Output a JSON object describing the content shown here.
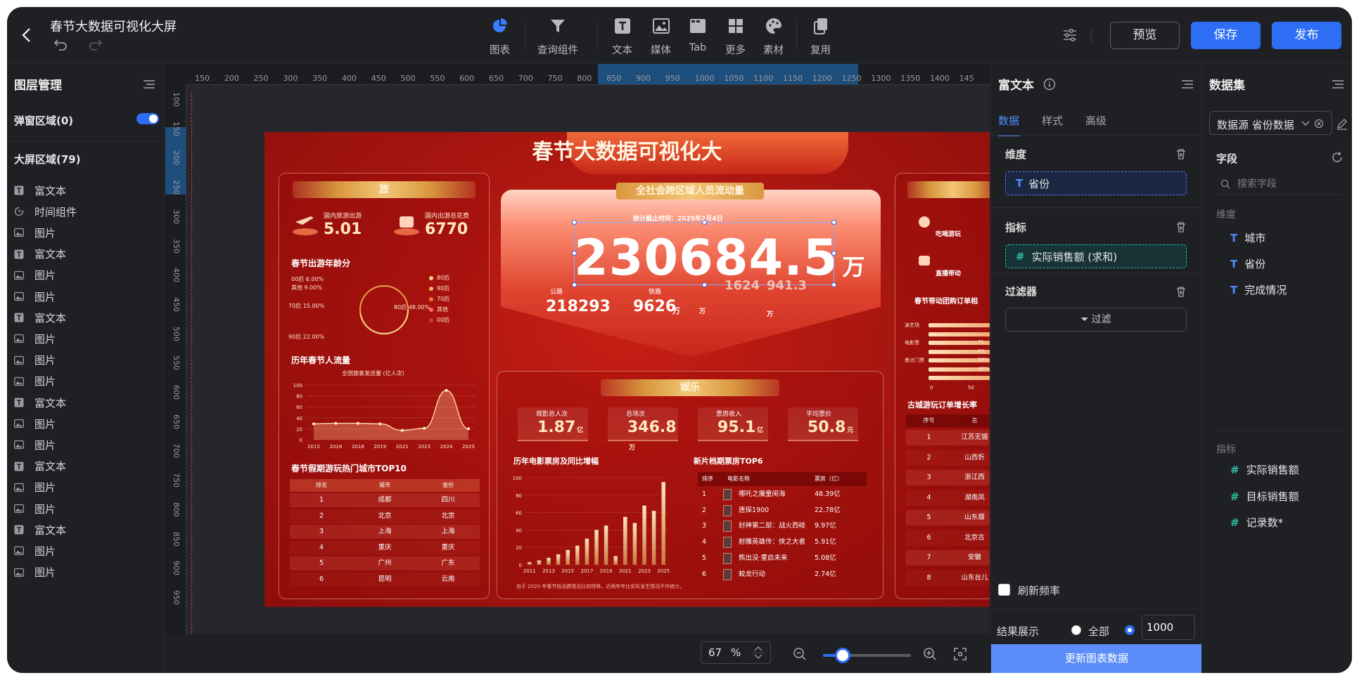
{
  "header": {
    "title": "春节大数据可视化大屏",
    "tools": [
      {
        "label": "图表",
        "icon": "pie-chart-icon"
      },
      {
        "label": "查询组件",
        "icon": "funnel-icon"
      },
      {
        "label": "文本",
        "icon": "text-icon"
      },
      {
        "label": "媒体",
        "icon": "image-icon"
      },
      {
        "label": "Tab",
        "icon": "tab-icon"
      },
      {
        "label": "更多",
        "icon": "grid-icon"
      },
      {
        "label": "素材",
        "icon": "palette-icon"
      },
      {
        "label": "复用",
        "icon": "copy-icon"
      }
    ],
    "preview": "预览",
    "save": "保存",
    "publish": "发布"
  },
  "layers": {
    "title": "图层管理",
    "popup_area": "弹窗区域(0)",
    "screen_area": "大屏区域(79)",
    "items": [
      {
        "label": "富文本",
        "type": "text"
      },
      {
        "label": "时间组件",
        "type": "time"
      },
      {
        "label": "图片",
        "type": "image"
      },
      {
        "label": "富文本",
        "type": "text"
      },
      {
        "label": "图片",
        "type": "image"
      },
      {
        "label": "图片",
        "type": "image"
      },
      {
        "label": "富文本",
        "type": "text"
      },
      {
        "label": "图片",
        "type": "image"
      },
      {
        "label": "图片",
        "type": "image"
      },
      {
        "label": "图片",
        "type": "image"
      },
      {
        "label": "富文本",
        "type": "text"
      },
      {
        "label": "图片",
        "type": "image"
      },
      {
        "label": "图片",
        "type": "image"
      },
      {
        "label": "富文本",
        "type": "text"
      },
      {
        "label": "图片",
        "type": "image"
      },
      {
        "label": "图片",
        "type": "image"
      },
      {
        "label": "富文本",
        "type": "text"
      },
      {
        "label": "图片",
        "type": "image"
      },
      {
        "label": "图片",
        "type": "image"
      }
    ]
  },
  "canvas": {
    "ruler_h": [
      "150",
      "200",
      "250",
      "300",
      "350",
      "400",
      "450",
      "500",
      "550",
      "600",
      "650",
      "700",
      "750",
      "800",
      "850",
      "900",
      "950",
      "1000",
      "1050",
      "1100",
      "1150",
      "1200",
      "1250",
      "1300",
      "1350",
      "1400",
      "145"
    ],
    "ruler_v": [
      "100",
      "150",
      "200",
      "250",
      "300",
      "350",
      "400",
      "450",
      "500",
      "550",
      "600",
      "650",
      "700",
      "750",
      "800",
      "850",
      "900",
      "950"
    ],
    "zoom_value": "67",
    "zoom_unit": "%"
  },
  "dashboard": {
    "title": "春节大数据可视化大",
    "travel": {
      "title": "旅",
      "domestic_trips_label": "国内旅游出游",
      "domestic_trips_value": "5.01",
      "domestic_spend_label": "国内出游总花费",
      "domestic_spend_value": "6770",
      "age_title": "春节出游年龄分",
      "age_labels": [
        "00后 6.00%",
        "其他 9.00%",
        "70后 15.00%",
        "90后 22.00%",
        "80后 48.00%"
      ],
      "legend": [
        "80后",
        "90后",
        "70后",
        "其他",
        "00后"
      ],
      "flow_title": "历年春节人流量",
      "flow_legend": "全国旅客发送量 (亿人次)",
      "flow_years": [
        "2015",
        "2016",
        "2018",
        "2019",
        "2021",
        "2023",
        "2024",
        "2025"
      ],
      "flow_y": [
        "100",
        "80",
        "60",
        "40",
        "20",
        "0"
      ],
      "top10_title": "春节假期游玩热门城市TOP10",
      "top10_headers": [
        "排名",
        "城市",
        "省份"
      ],
      "top10_rows": [
        [
          "1",
          "成都",
          "四川"
        ],
        [
          "2",
          "北京",
          "北京"
        ],
        [
          "3",
          "上海",
          "上海"
        ],
        [
          "4",
          "重庆",
          "重庆"
        ],
        [
          "5",
          "广州",
          "广东"
        ],
        [
          "6",
          "昆明",
          "云南"
        ]
      ]
    },
    "flow": {
      "title": "全社会跨区域人员流动量",
      "as_of": "统计截止时间：2025年2月4日",
      "total": "230684.5",
      "total_unit": "万",
      "road_label": "公路",
      "road_value": "218293",
      "rail_label": "铁路",
      "rail_value": "9626",
      "unit": "万",
      "hidden_a": "1624",
      "hidden_b": "941.3"
    },
    "ent": {
      "title": "娱乐",
      "kpis": [
        {
          "label": "观影总人次",
          "value": "1.87",
          "unit": "亿"
        },
        {
          "label": "总场次",
          "value": "346.8",
          "unit": "万"
        },
        {
          "label": "票房收入",
          "value": "95.1",
          "unit": "亿"
        },
        {
          "label": "平均票价",
          "value": "50.8",
          "unit": "元"
        }
      ],
      "box_title": "历年电影票房及同比增幅",
      "box_years": [
        "2011",
        "2013",
        "2015",
        "2017",
        "2019",
        "2021",
        "2023",
        "2025"
      ],
      "box_y": [
        "100",
        "80",
        "60",
        "40",
        "20",
        "0"
      ],
      "box_note": "由于 2020 年春节档消费情况比较特殊，近两年年比实际发生情况不作统计。",
      "top6_title": "新片档期票房TOP6",
      "top6_headers": [
        "排序",
        "电影名称",
        "票房（亿）"
      ],
      "top6_rows": [
        [
          "1",
          "哪吒之魔童闹海",
          "48.39亿"
        ],
        [
          "2",
          "唐探1900",
          "22.78亿"
        ],
        [
          "3",
          "封神第二部：战火西岐",
          "9.97亿"
        ],
        [
          "4",
          "射雕英雄传：侠之大者",
          "5.91亿"
        ],
        [
          "5",
          "熊出没·重启未来",
          "5.08亿"
        ],
        [
          "6",
          "蛟龙行动",
          "2.74亿"
        ]
      ]
    },
    "right": {
      "food_label": "吃喝游玩",
      "live_label": "直播带动",
      "orders_title": "春节带动团购订单相",
      "bar_labels": [
        "演艺场",
        "电影票",
        "景点门票"
      ],
      "pct": [
        "71",
        "69",
        "58%",
        "48%"
      ],
      "axis": [
        "0",
        "50"
      ],
      "growth_title": "古城游玩订单增长率",
      "growth_headers": [
        "序号",
        "古"
      ],
      "growth_rows": [
        [
          "1",
          "江苏无锡"
        ],
        [
          "2",
          "山西忻"
        ],
        [
          "3",
          "浙江西"
        ],
        [
          "4",
          "湖南凤"
        ],
        [
          "5",
          "山东烟"
        ],
        [
          "6",
          "北京古"
        ],
        [
          "7",
          "安徽"
        ],
        [
          "8",
          "山东台儿"
        ]
      ]
    }
  },
  "props": {
    "title": "富文本",
    "tabs": [
      "数据",
      "样式",
      "高级"
    ],
    "dimension_label": "维度",
    "dimension_field": "省份",
    "measure_label": "指标",
    "measure_field": "实际销售额 (求和)",
    "filter_label": "过滤器",
    "filter_button": "过滤",
    "refresh_label": "刷新频率",
    "result_label": "结果展示",
    "result_all": "全部",
    "result_count": "1000",
    "update_button": "更新图表数据"
  },
  "dataset": {
    "title": "数据集",
    "source": "数据源 省份数据",
    "fields_label": "字段",
    "search_placeholder": "搜索字段",
    "dim_label": "维度",
    "dimensions": [
      "城市",
      "省份",
      "完成情况"
    ],
    "measure_label": "指标",
    "measures": [
      "实际销售额",
      "目标销售额",
      "记录数*"
    ]
  },
  "chart_data": [
    {
      "type": "line",
      "title": "历年春节人流量",
      "series": [
        {
          "name": "全国旅客发送量 (亿人次)",
          "values": [
            29,
            30,
            30,
            29,
            17,
            21,
            90,
            20
          ]
        }
      ],
      "categories": [
        "2015",
        "2016",
        "2018",
        "2019",
        "2021",
        "2023",
        "2024",
        "2025"
      ],
      "ylim": [
        0,
        100
      ]
    },
    {
      "type": "bar",
      "title": "历年电影票房及同比增幅",
      "categories": [
        "2011",
        "2012",
        "2013",
        "2014",
        "2015",
        "2016",
        "2017",
        "2018",
        "2019",
        "2020",
        "2021",
        "2022",
        "2023",
        "2024",
        "2025"
      ],
      "values": [
        3,
        5,
        8,
        12,
        17,
        22,
        30,
        40,
        45,
        10,
        55,
        48,
        68,
        62,
        95
      ],
      "ylim": [
        0,
        100
      ]
    },
    {
      "type": "pie",
      "title": "春节出游年龄分",
      "categories": [
        "80后",
        "90后",
        "70后",
        "其他",
        "00后"
      ],
      "values": [
        48,
        22,
        15,
        9,
        6
      ]
    }
  ]
}
